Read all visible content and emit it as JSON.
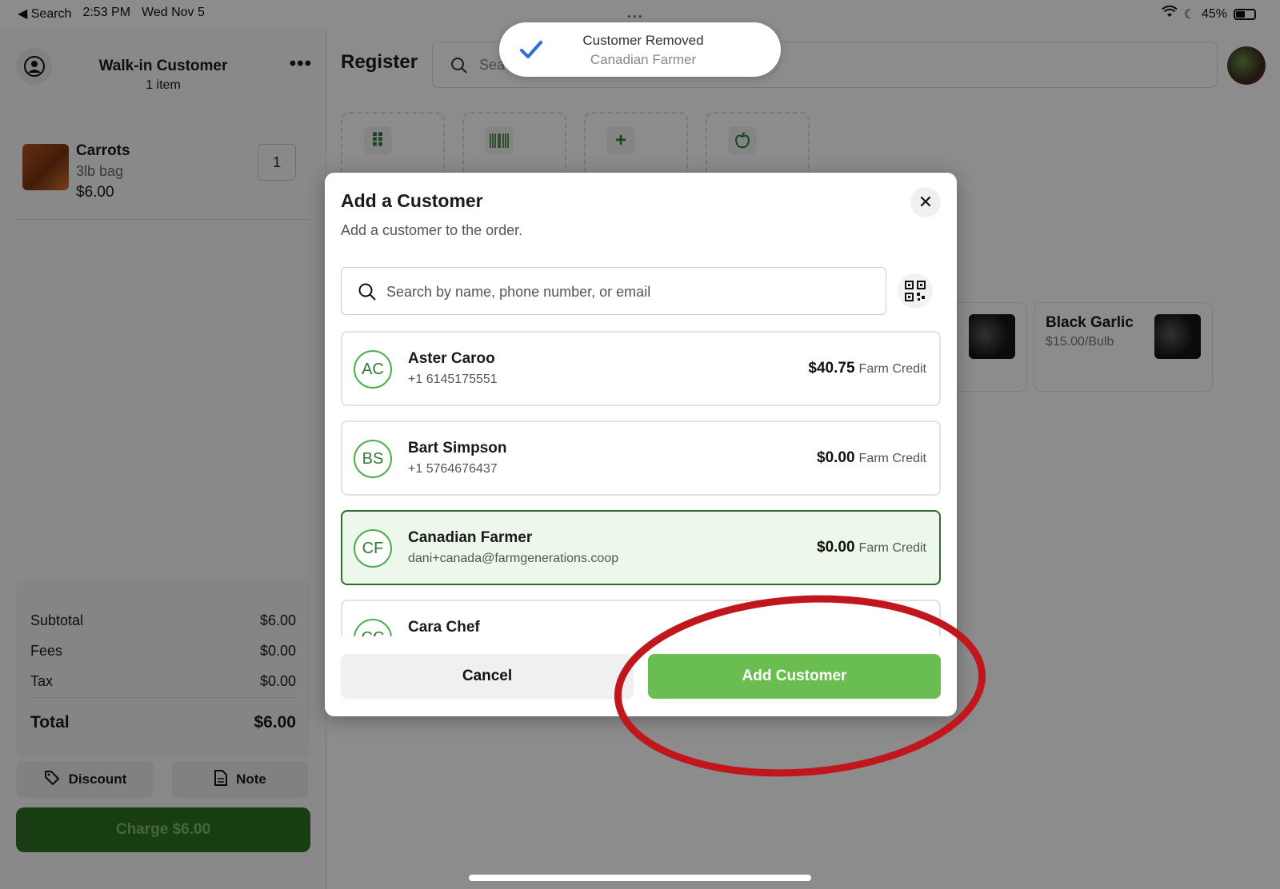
{
  "status_bar": {
    "back": "◀ Search",
    "time": "2:53 PM",
    "date": "Wed Nov 5",
    "battery": "45%"
  },
  "sidebar": {
    "customer_title": "Walk-in Customer",
    "customer_sub": "1 item",
    "cart": [
      {
        "name": "Carrots",
        "variant": "3lb bag",
        "price": "$6.00",
        "qty": "1"
      }
    ],
    "totals": {
      "subtotal_label": "Subtotal",
      "subtotal": "$6.00",
      "fees_label": "Fees",
      "fees": "$0.00",
      "tax_label": "Tax",
      "tax": "$0.00",
      "total_label": "Total",
      "total": "$6.00"
    },
    "discount_label": "Discount",
    "note_label": "Note",
    "charge_label": "Charge $6.00"
  },
  "main": {
    "title": "Register",
    "search_visible": "Sea",
    "products": [
      {
        "name": "Black Garlic",
        "price": "$15.00/Bulb"
      }
    ]
  },
  "toast": {
    "title": "Customer Removed",
    "subtitle": "Canadian Farmer"
  },
  "modal": {
    "title": "Add a Customer",
    "subtitle": "Add a customer to the order.",
    "search_placeholder": "Search by name, phone number, or email",
    "credit_label": "Farm Credit",
    "customers": [
      {
        "initials": "AC",
        "name": "Aster Caroo",
        "contact": "+1 6145175551",
        "credit": "$40.75",
        "selected": false
      },
      {
        "initials": "BS",
        "name": "Bart Simpson",
        "contact": "+1 5764676437",
        "credit": "$0.00",
        "selected": false
      },
      {
        "initials": "CF",
        "name": "Canadian Farmer",
        "contact": "dani+canada@farmgenerations.coop",
        "credit": "$0.00",
        "selected": true
      },
      {
        "initials": "CC",
        "name": "Cara Chef",
        "contact": "",
        "credit": "",
        "selected": false
      }
    ],
    "cancel_label": "Cancel",
    "add_label": "Add Customer"
  },
  "colors": {
    "accent_green": "#6abe50",
    "selected_border": "#2f6b2a",
    "annotation_red": "#c0161c"
  }
}
